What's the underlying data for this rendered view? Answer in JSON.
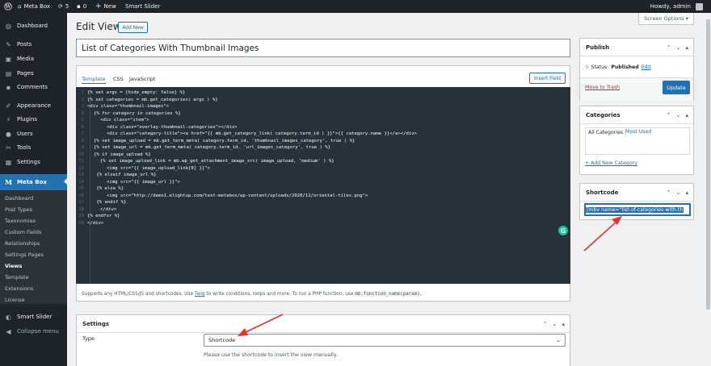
{
  "admin_bar": {
    "site_name": "Meta Box",
    "updates": "5",
    "comments": "0",
    "new": "New",
    "plugin": "Smart Slider",
    "howdy": "Howdy, admin"
  },
  "sidebar": {
    "items": [
      {
        "label": "Dashboard",
        "icon": "dashboard-icon"
      },
      {
        "label": "Posts",
        "icon": "pin-icon"
      },
      {
        "label": "Media",
        "icon": "media-icon"
      },
      {
        "label": "Pages",
        "icon": "page-icon"
      },
      {
        "label": "Comments",
        "icon": "comment-icon"
      },
      {
        "label": "Appearance",
        "icon": "brush-icon"
      },
      {
        "label": "Plugins",
        "icon": "plugin-icon"
      },
      {
        "label": "Users",
        "icon": "users-icon"
      },
      {
        "label": "Tools",
        "icon": "wrench-icon"
      },
      {
        "label": "Settings",
        "icon": "settings-icon"
      },
      {
        "label": "Meta Box",
        "icon": "metabox-logo-icon"
      }
    ],
    "submenu": [
      "Dashboard",
      "Post Types",
      "Taxonomies",
      "Custom Fields",
      "Relationships",
      "Settings Pages",
      "Views",
      "Template",
      "Extensions",
      "License"
    ],
    "smart_slider": "Smart Slider",
    "collapse": "Collapse menu"
  },
  "screen_options": "Screen Options",
  "page": {
    "title": "Edit View",
    "add_new": "Add New",
    "post_title": "List of Categories With Thumbnail Images"
  },
  "editor": {
    "tabs": [
      "Template",
      "CSS",
      "JavaScript"
    ],
    "insert_field": "Insert Field",
    "code_lines": [
      {
        "n": "1",
        "ind": 0,
        "t": "{% set args = {hide_empty: false} %}"
      },
      {
        "n": "2",
        "ind": 0,
        "t": "{% set categories = mb.get_categories( args ) %}"
      },
      {
        "n": "3",
        "ind": 0,
        "t": "<div class=\"thumbnail-images\">"
      },
      {
        "n": "4",
        "ind": 1,
        "t": "{% for category in categories %}"
      },
      {
        "n": "5",
        "ind": 2,
        "t": "<div class=\"item\">"
      },
      {
        "n": "6",
        "ind": 3,
        "t": "<div class=\"overlay-thumbnail-categories\"></div>"
      },
      {
        "n": "7",
        "ind": 3,
        "t": "<div class=\"category-title\"><a href=\"{{ mb.get_category_link( category.term_id ) }}\">{{ category.name }}</a></div>"
      },
      {
        "n": "8",
        "ind": 1,
        "t": "{% set image_upload = mb.get_term_meta( category.term_id, 'thumbnail_images_category', true ) %}"
      },
      {
        "n": "9",
        "ind": 1,
        "t": "{% set image_url = mb.get_term_meta( category.term_id, 'url_images_category', true ) %}"
      },
      {
        "n": "10",
        "ind": 1,
        "t": "{% if image_upload %}"
      },
      {
        "n": "11",
        "ind": 2,
        "t": "{% set image_upload_link = mb.wp_get_attachment_image_src( image_upload, 'medium' ) %}"
      },
      {
        "n": "12",
        "ind": 3,
        "t": "<img src=\"{{ image_upload_link[0] }}\">"
      },
      {
        "n": "13",
        "ind": 1,
        "t": " {% elseif image_url %}"
      },
      {
        "n": "14",
        "ind": 3,
        "t": "<img src=\"{{ image_url }}\">"
      },
      {
        "n": "15",
        "ind": 1,
        "t": " {% else %}"
      },
      {
        "n": "16",
        "ind": 3,
        "t": "<img src=\"http://demo1.elightup.com/test-metabox/wp-content/uploads/2020/11/oriental-tiles.png\">"
      },
      {
        "n": "17",
        "ind": 1,
        "t": " {% endif %}"
      },
      {
        "n": "18",
        "ind": 2,
        "t": "</div>"
      },
      {
        "n": "19",
        "ind": 0,
        "t": "{% endfor %}"
      },
      {
        "n": "20",
        "ind": 0,
        "t": "</div>"
      }
    ],
    "help_before": "Supports any HTML/CSS/JS and shortcodes. Use ",
    "help_link": "Twig",
    "help_mid": " to write conditions, loops and more. To run a PHP function, use ",
    "help_code": "mb.function_name(param)",
    "help_end": "."
  },
  "settings": {
    "title": "Settings",
    "type_label": "Type",
    "type_value": "Shortcode",
    "hint": "Please use the shortcode to insert the view manually."
  },
  "publish": {
    "title": "Publish",
    "status_label": "Status:",
    "status_value": "Published",
    "edit": "Edit",
    "trash": "Move to Trash",
    "update": "Update"
  },
  "categories": {
    "title": "Categories",
    "tab_all": "All Categories",
    "tab_used": "Most Used",
    "add_new": "+ Add New Category"
  },
  "shortcode": {
    "title": "Shortcode",
    "value": "[mbv name=\"list-of-categories-with-th"
  },
  "colors": {
    "accent": "#2271b1",
    "admin_bar": "#1d2327",
    "code_bg": "#263238",
    "annotation": "#e0342c",
    "trash": "#b32d2e"
  }
}
